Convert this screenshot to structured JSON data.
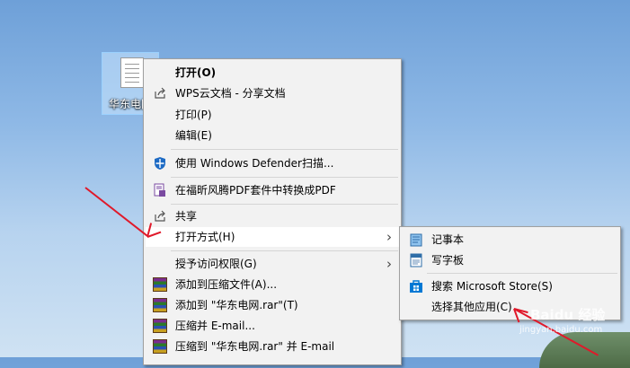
{
  "desktop_icon": {
    "label": "华东电网"
  },
  "context_menu": {
    "items": [
      {
        "label": "打开(O)",
        "bold": true
      },
      {
        "label": "WPS云文档 - 分享文档",
        "icon": "share-icon"
      },
      {
        "label": "打印(P)"
      },
      {
        "label": "编辑(E)"
      },
      {
        "label": "使用 Windows Defender扫描...",
        "icon": "defender-shield-icon"
      },
      {
        "label": "在福昕风腾PDF套件中转换成PDF",
        "icon": "pdf-convert-icon"
      },
      {
        "label": "共享",
        "icon": "share-icon"
      },
      {
        "label": "打开方式(H)",
        "has_submenu": true
      },
      {
        "label": "授予访问权限(G)",
        "has_submenu": true
      },
      {
        "label": "添加到压缩文件(A)...",
        "icon": "winrar-icon"
      },
      {
        "label": "添加到 \"华东电网.rar\"(T)",
        "icon": "winrar-icon"
      },
      {
        "label": "压缩并 E-mail...",
        "icon": "winrar-icon"
      },
      {
        "label": "压缩到 \"华东电网.rar\" 并 E-mail",
        "icon": "winrar-icon"
      }
    ]
  },
  "open_with_submenu": {
    "items": [
      {
        "label": "记事本",
        "icon": "notepad-icon"
      },
      {
        "label": "写字板",
        "icon": "wordpad-icon"
      },
      {
        "label": "搜索 Microsoft Store(S)",
        "icon": "store-icon"
      },
      {
        "label": "选择其他应用(C)"
      }
    ]
  },
  "watermark": {
    "text": "Baidu 经验",
    "url": "jingyan.baidu.com"
  },
  "colors": {
    "menu_bg": "#f2f2f2",
    "highlight": "#ffffff",
    "annotation_arrow": "#e0192a"
  }
}
